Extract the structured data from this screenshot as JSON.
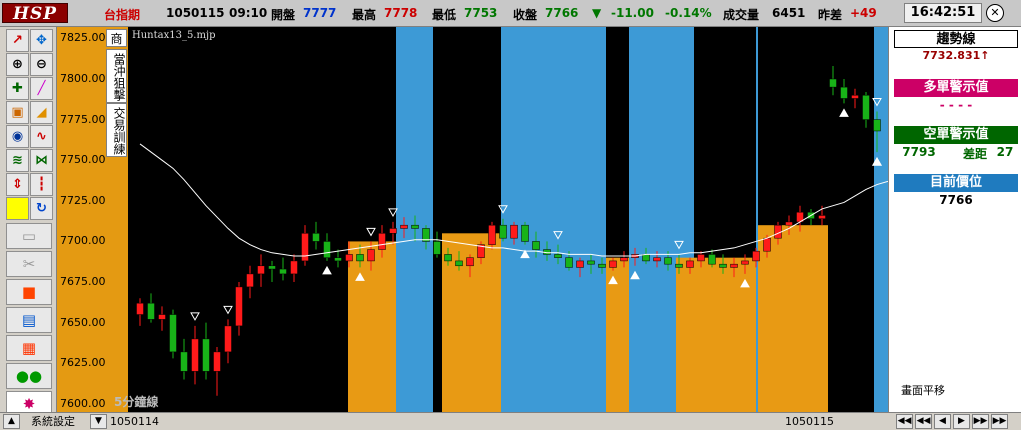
{
  "header": {
    "logo": "HSP",
    "symbol": "台指期",
    "date": "1050115",
    "time": "09:10",
    "open_label": "開盤",
    "open_value": "7777",
    "high_label": "最高",
    "high_value": "7778",
    "low_label": "最低",
    "low_value": "7753",
    "close_label": "收盤",
    "close_value": "7766",
    "change_arrow": "▼",
    "change_value": "-11.00",
    "change_pct": "-0.14%",
    "volume_label": "成交量",
    "volume_value": "6451",
    "prev_label": "昨差",
    "prev_value": "+49",
    "clock": "16:42:51",
    "close_button": "✕"
  },
  "toolbar": {
    "icons": [
      "trend-line-icon",
      "cross-move-icon",
      "zoom-in-icon",
      "zoom-out-icon",
      "crosshair-icon",
      "pen-icon",
      "lock-icon",
      "eraser-icon",
      "compass-icon",
      "wave-icon",
      "chart-curve-icon",
      "link-icon",
      "arrow-icon",
      "candle-icon",
      "color-icon",
      "refresh-icon",
      "folder-icon",
      "tools-icon",
      "stop-icon",
      "report-icon",
      "grid-icon",
      "people-icon",
      "star-burst-icon"
    ]
  },
  "tabs": {
    "tab1": "商",
    "tab2": "當沖狙擊",
    "tab3": "交易訓練"
  },
  "chart": {
    "indicator_name": "Huntax13_5.mjp",
    "period_label": "5分鐘線",
    "x_start": "1050114",
    "x_end": "1050115",
    "colors": {
      "up": "#ff1a1a",
      "down": "#18b318",
      "fill_orange": "#e89a14",
      "fill_blue": "#3d9ad6",
      "ma": "#ffffff"
    }
  },
  "chart_data": {
    "type": "candlestick",
    "y_ticks": [
      "7825.00",
      "7800.00",
      "7775.00",
      "7750.00",
      "7725.00",
      "7700.00",
      "7675.00",
      "7650.00",
      "7625.00",
      "7600.00"
    ],
    "ylim": [
      7595,
      7832
    ],
    "x_labels": [
      "1050114",
      "1050115"
    ],
    "candles": [
      [
        7655,
        7665,
        7648,
        7662
      ],
      [
        7662,
        7668,
        7650,
        7652
      ],
      [
        7652,
        7660,
        7645,
        7655
      ],
      [
        7655,
        7658,
        7628,
        7632
      ],
      [
        7632,
        7640,
        7615,
        7620
      ],
      [
        7620,
        7648,
        7612,
        7640
      ],
      [
        7640,
        7650,
        7615,
        7620
      ],
      [
        7620,
        7635,
        7605,
        7632
      ],
      [
        7632,
        7652,
        7625,
        7648
      ],
      [
        7648,
        7675,
        7642,
        7672
      ],
      [
        7672,
        7685,
        7665,
        7680
      ],
      [
        7680,
        7692,
        7672,
        7685
      ],
      [
        7685,
        7688,
        7675,
        7683
      ],
      [
        7683,
        7690,
        7676,
        7680
      ],
      [
        7680,
        7692,
        7675,
        7688
      ],
      [
        7688,
        7710,
        7685,
        7705
      ],
      [
        7705,
        7712,
        7695,
        7700
      ],
      [
        7700,
        7705,
        7688,
        7690
      ],
      [
        7690,
        7695,
        7684,
        7688
      ],
      [
        7688,
        7700,
        7684,
        7692
      ],
      [
        7692,
        7698,
        7684,
        7688
      ],
      [
        7688,
        7700,
        7682,
        7695
      ],
      [
        7695,
        7710,
        7690,
        7705
      ],
      [
        7705,
        7712,
        7698,
        7708
      ],
      [
        7708,
        7715,
        7702,
        7710
      ],
      [
        7710,
        7716,
        7700,
        7708
      ],
      [
        7708,
        7710,
        7695,
        7700
      ],
      [
        7700,
        7706,
        7690,
        7692
      ],
      [
        7692,
        7696,
        7685,
        7688
      ],
      [
        7688,
        7694,
        7682,
        7685
      ],
      [
        7685,
        7692,
        7678,
        7690
      ],
      [
        7690,
        7700,
        7686,
        7698
      ],
      [
        7698,
        7712,
        7695,
        7710
      ],
      [
        7710,
        7714,
        7700,
        7702
      ],
      [
        7702,
        7712,
        7698,
        7710
      ],
      [
        7710,
        7712,
        7698,
        7700
      ],
      [
        7700,
        7706,
        7690,
        7695
      ],
      [
        7695,
        7700,
        7688,
        7692
      ],
      [
        7692,
        7698,
        7686,
        7690
      ],
      [
        7690,
        7694,
        7682,
        7684
      ],
      [
        7684,
        7690,
        7678,
        7688
      ],
      [
        7688,
        7692,
        7680,
        7686
      ],
      [
        7686,
        7690,
        7680,
        7684
      ],
      [
        7684,
        7690,
        7682,
        7688
      ],
      [
        7688,
        7694,
        7684,
        7690
      ],
      [
        7690,
        7696,
        7685,
        7692
      ],
      [
        7692,
        7696,
        7686,
        7688
      ],
      [
        7688,
        7694,
        7684,
        7690
      ],
      [
        7690,
        7694,
        7682,
        7686
      ],
      [
        7686,
        7692,
        7680,
        7684
      ],
      [
        7684,
        7690,
        7680,
        7688
      ],
      [
        7688,
        7694,
        7684,
        7692
      ],
      [
        7692,
        7695,
        7684,
        7686
      ],
      [
        7686,
        7692,
        7680,
        7684
      ],
      [
        7684,
        7690,
        7678,
        7686
      ],
      [
        7686,
        7692,
        7680,
        7688
      ],
      [
        7688,
        7696,
        7684,
        7694
      ],
      [
        7694,
        7704,
        7690,
        7702
      ],
      [
        7702,
        7712,
        7698,
        7710
      ],
      [
        7710,
        7716,
        7704,
        7712
      ],
      [
        7712,
        7722,
        7706,
        7718
      ],
      [
        7718,
        7720,
        7710,
        7714
      ],
      [
        7714,
        7722,
        7710,
        7716
      ],
      [
        7800,
        7808,
        7790,
        7795
      ],
      [
        7795,
        7800,
        7785,
        7788
      ],
      [
        7788,
        7794,
        7782,
        7790
      ],
      [
        7790,
        7792,
        7770,
        7775
      ],
      [
        7775,
        7780,
        7755,
        7768
      ]
    ],
    "ma": [
      7760,
      7755,
      7750,
      7745,
      7738,
      7730,
      7722,
      7715,
      7708,
      7702,
      7698,
      7695,
      7693,
      7692,
      7691,
      7691,
      7692,
      7693,
      7694,
      7695,
      7696,
      7697,
      7698,
      7699,
      7700,
      7701,
      7701,
      7701,
      7700,
      7699,
      7698,
      7697,
      7696,
      7696,
      7695,
      7694,
      7694,
      7693,
      7693,
      7692,
      7692,
      7692,
      7691,
      7691,
      7691,
      7691,
      7692,
      7692,
      7692,
      7692,
      7693,
      7693,
      7694,
      7695,
      7696,
      7698,
      7700,
      7702,
      7705,
      7708,
      7712,
      7716,
      7720,
      7722,
      7724,
      7728,
      7732,
      7735,
      7737
    ],
    "up_markers": [
      17,
      20,
      35,
      43,
      45,
      55,
      64,
      70,
      72,
      76
    ],
    "down_markers": [
      5,
      8,
      21,
      23,
      33,
      38,
      49,
      71
    ]
  },
  "right_panel": {
    "trend_label": "趨勢線",
    "trend_value": "7732.831↑",
    "long_label": "多單警示值",
    "long_value": "- - - -",
    "short_label": "空單警示值",
    "short_value": "7793",
    "gap_label": "差距",
    "gap_value": "27",
    "position_label": "目前價位",
    "position_value": "7766",
    "scroll_label": "畫面平移"
  },
  "status": {
    "settings": "系統設定",
    "date_field": "1050114"
  }
}
